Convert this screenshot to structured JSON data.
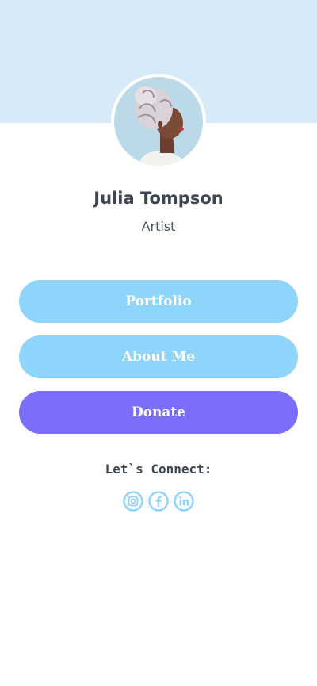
{
  "profile": {
    "name": "Julia Tompson",
    "role": "Artist"
  },
  "buttons": {
    "portfolio": "Portfolio",
    "about": "About Me",
    "donate": "Donate"
  },
  "connect": {
    "heading": "Let`s Connect:",
    "icons": [
      "instagram-icon",
      "facebook-icon",
      "linkedin-icon"
    ]
  },
  "colors": {
    "cover": "#d6ebf7",
    "primary_button": "#8dd5fa",
    "donate_button": "#7b6ffa",
    "text": "#3d4650"
  }
}
